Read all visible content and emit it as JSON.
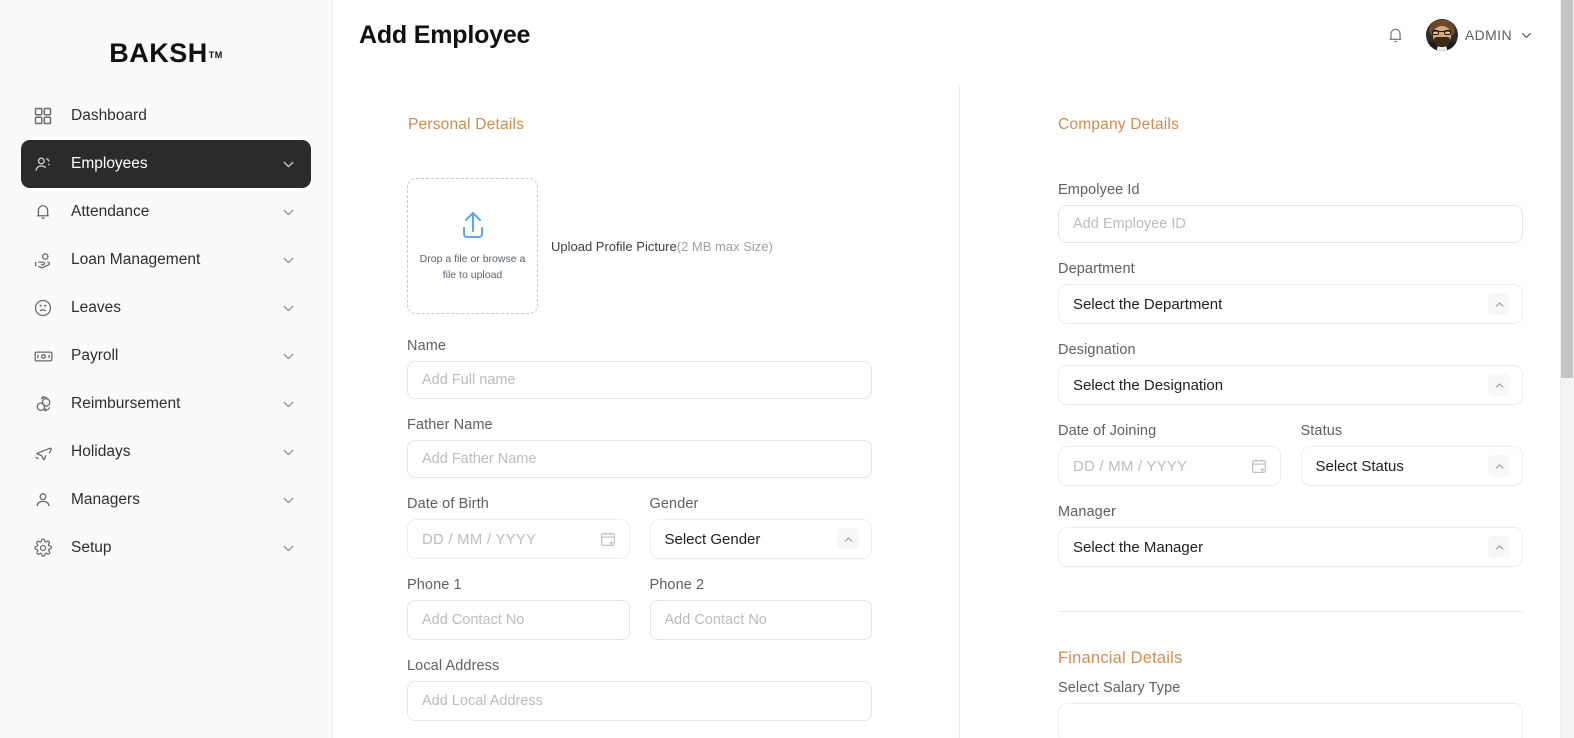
{
  "brand": {
    "name": "BAKSH",
    "tm": "TM"
  },
  "sidebar": {
    "items": [
      {
        "label": "Dashboard",
        "icon": "grid-icon",
        "active": false,
        "caret": false
      },
      {
        "label": "Employees",
        "icon": "users-icon",
        "active": true,
        "caret": true
      },
      {
        "label": "Attendance",
        "icon": "bell-icon",
        "active": false,
        "caret": true
      },
      {
        "label": "Loan Management",
        "icon": "hand-coin-icon",
        "active": false,
        "caret": true
      },
      {
        "label": "Leaves",
        "icon": "sad-face-icon",
        "active": false,
        "caret": true
      },
      {
        "label": "Payroll",
        "icon": "banknote-icon",
        "active": false,
        "caret": true
      },
      {
        "label": "Reimbursement",
        "icon": "refresh-coin-icon",
        "active": false,
        "caret": true
      },
      {
        "label": "Holidays",
        "icon": "airplane-icon",
        "active": false,
        "caret": true
      },
      {
        "label": "Managers",
        "icon": "user-icon",
        "active": false,
        "caret": true
      },
      {
        "label": "Setup",
        "icon": "gear-icon",
        "active": false,
        "caret": true
      }
    ]
  },
  "topbar": {
    "title": "Add Employee",
    "notification_icon": "bell-icon",
    "user_name": "ADMIN",
    "user_caret_icon": "chevron-down-icon",
    "avatar_icon": "user-avatar"
  },
  "personal": {
    "section_title": "Personal Details",
    "dropzone": {
      "text": "Drop a file or browse a file to upload",
      "icon": "upload-icon"
    },
    "upload_caption": "Upload Profile Picture",
    "upload_caption_note": "(2 MB max Size)",
    "fields": {
      "name_label": "Name",
      "name_placeholder": "Add Full name",
      "father_label": "Father Name",
      "father_placeholder": "Add Father Name",
      "dob_label": "Date of Birth",
      "dob_placeholder": "DD / MM / YYYY",
      "gender_label": "Gender",
      "gender_value": "Select Gender",
      "phone1_label": "Phone 1",
      "phone1_placeholder": "Add Contact No",
      "phone2_label": "Phone 2",
      "phone2_placeholder": "Add Contact No",
      "address_label": "Local Address",
      "address_placeholder": "Add Local Address"
    }
  },
  "company": {
    "section_title": "Company Details",
    "fields": {
      "empid_label": "Empolyee Id",
      "empid_placeholder": "Add Employee ID",
      "department_label": "Department",
      "department_value": "Select the Department",
      "designation_label": "Designation",
      "designation_value": "Select the Designation",
      "doj_label": "Date of Joining",
      "doj_placeholder": "DD / MM / YYYY",
      "status_label": "Status",
      "status_value": "Select Status",
      "manager_label": "Manager",
      "manager_value": "Select the Manager"
    }
  },
  "financial": {
    "section_title": "Financial Details",
    "salary_type_label": "Select Salary Type"
  },
  "colors": {
    "accent": "#cf8b4e",
    "active_nav_bg": "#2b2b2b",
    "upload_icon": "#5aa9e6",
    "sidebar_bg": "#fafafa",
    "border": "#e6e6e6"
  }
}
